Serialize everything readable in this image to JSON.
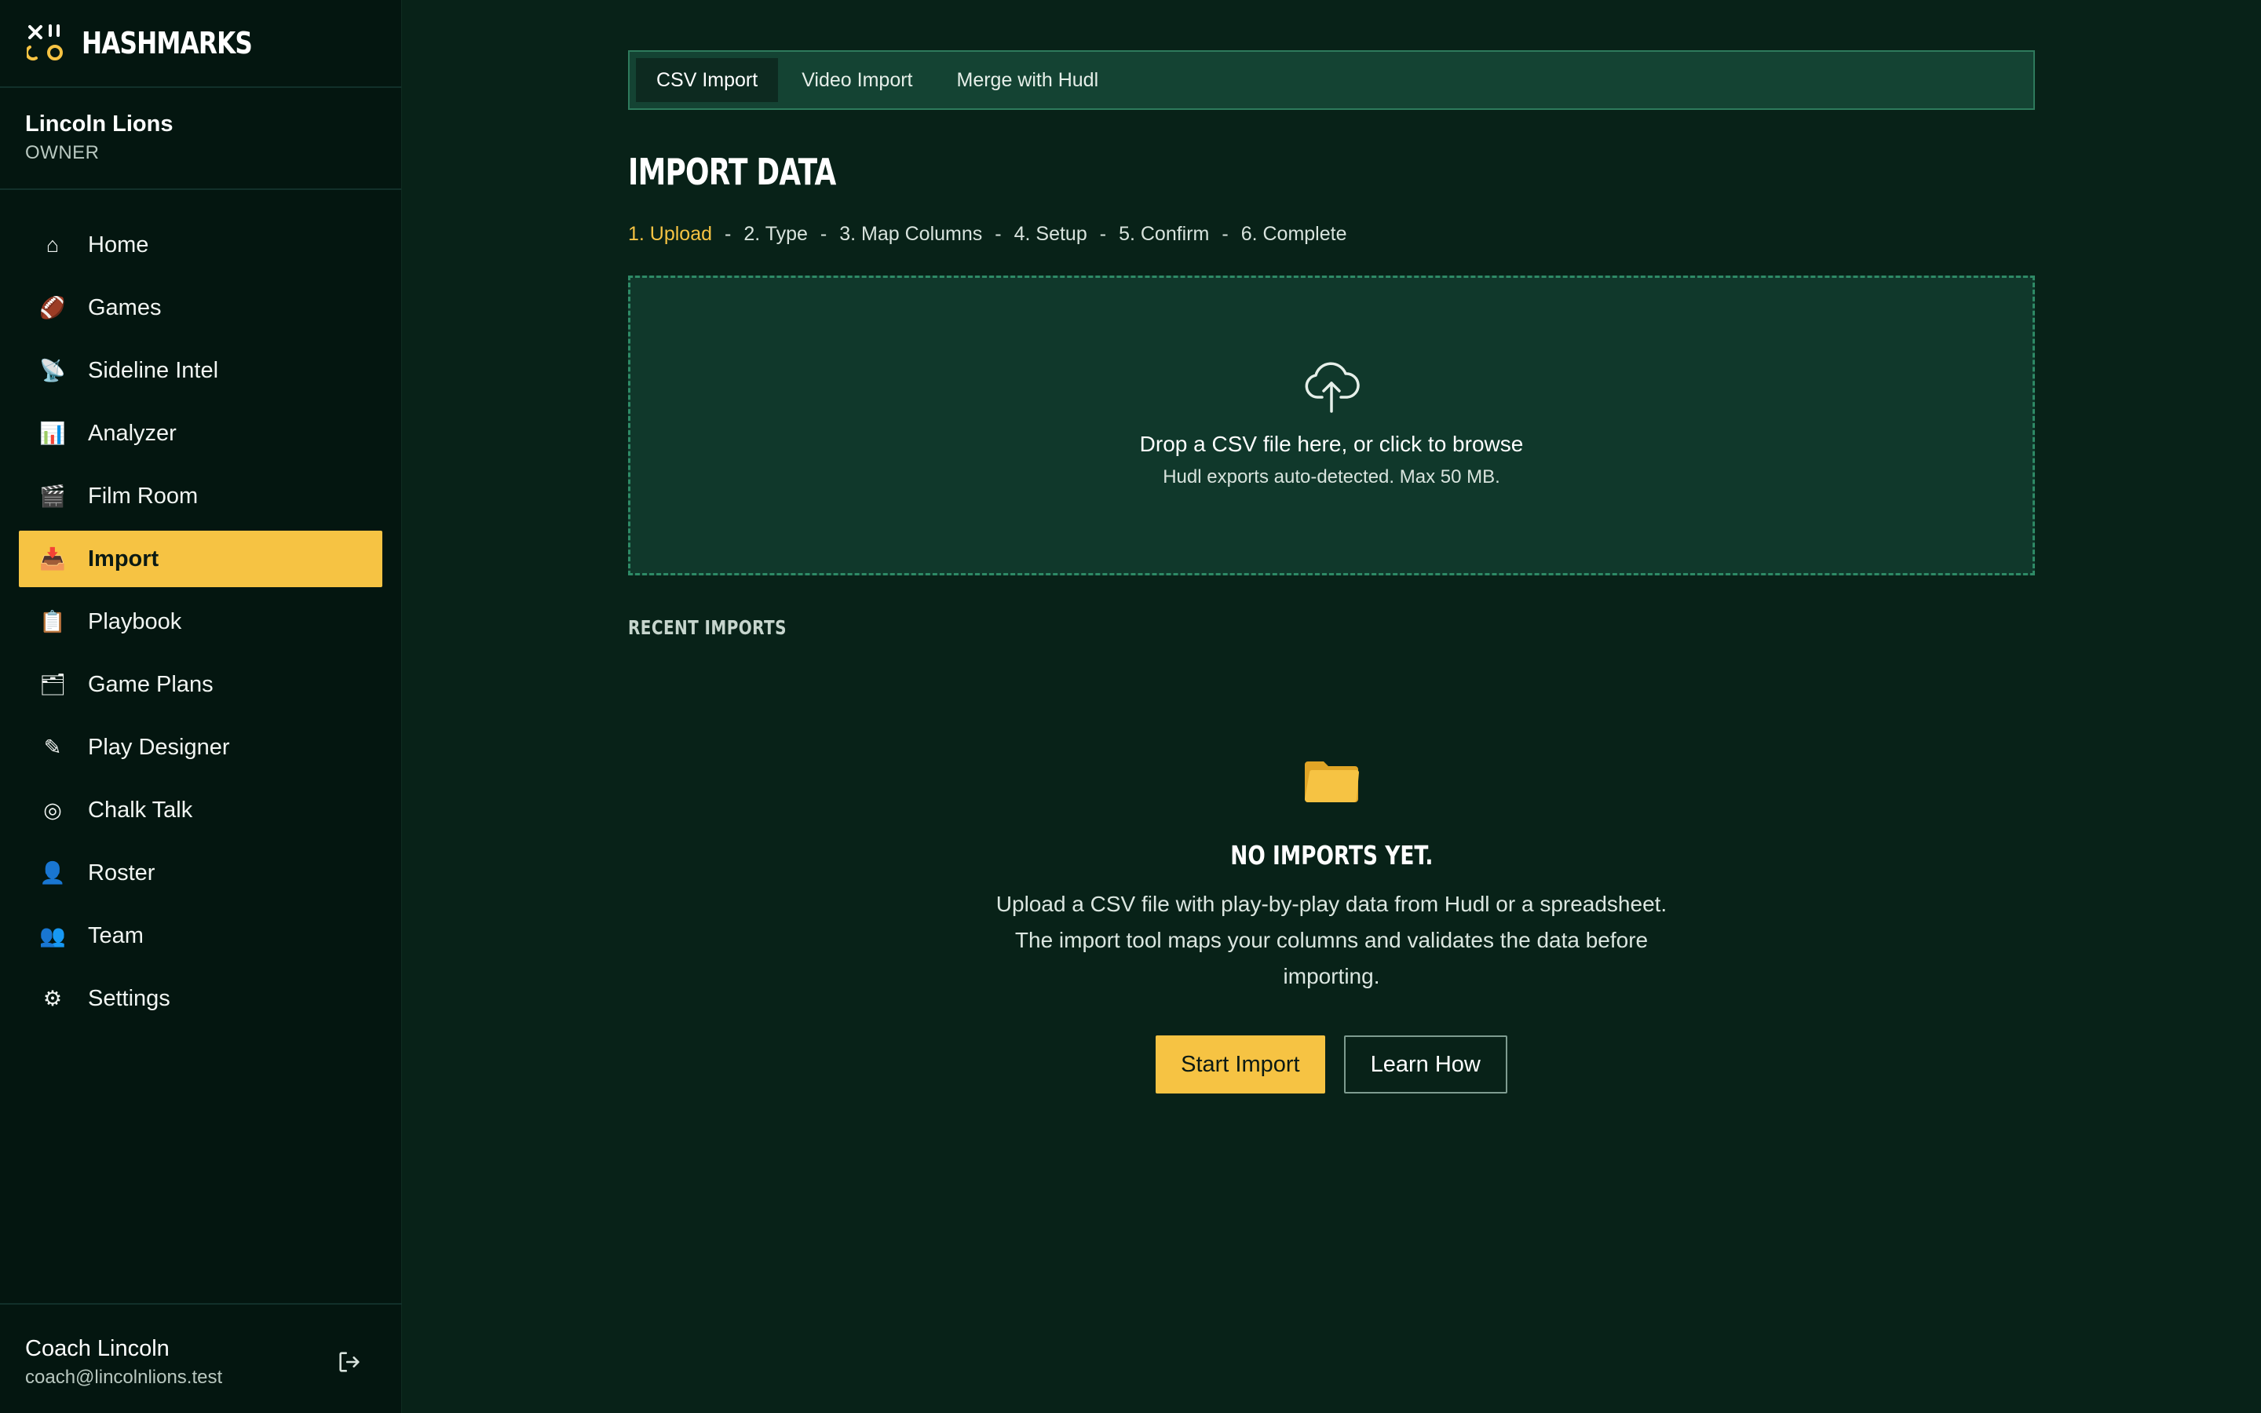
{
  "app": {
    "name": "HASHMARKS"
  },
  "team": {
    "name": "Lincoln Lions",
    "role": "OWNER"
  },
  "sidebar": {
    "items": [
      {
        "label": "Home",
        "icon": "⌂",
        "icon_name": "home-icon"
      },
      {
        "label": "Games",
        "icon": "🏈",
        "icon_name": "football-icon"
      },
      {
        "label": "Sideline Intel",
        "icon": "📡",
        "icon_name": "satellite-icon"
      },
      {
        "label": "Analyzer",
        "icon": "📊",
        "icon_name": "bar-chart-icon"
      },
      {
        "label": "Film Room",
        "icon": "🎬",
        "icon_name": "clapperboard-icon"
      },
      {
        "label": "Import",
        "icon": "📥",
        "icon_name": "inbox-tray-icon",
        "active": true
      },
      {
        "label": "Playbook",
        "icon": "📋",
        "icon_name": "clipboard-icon"
      },
      {
        "label": "Game Plans",
        "icon": "🗂",
        "icon_name": "card-index-icon"
      },
      {
        "label": "Play Designer",
        "icon": "✎",
        "icon_name": "pencil-icon"
      },
      {
        "label": "Chalk Talk",
        "icon": "◎",
        "icon_name": "target-icon"
      },
      {
        "label": "Roster",
        "icon": "👤",
        "icon_name": "person-icon"
      },
      {
        "label": "Team",
        "icon": "👥",
        "icon_name": "people-icon"
      },
      {
        "label": "Settings",
        "icon": "⚙",
        "icon_name": "gear-icon"
      }
    ]
  },
  "user": {
    "name": "Coach Lincoln",
    "email": "coach@lincolnlions.test"
  },
  "tabs": [
    {
      "label": "CSV Import",
      "active": true
    },
    {
      "label": "Video Import"
    },
    {
      "label": "Merge with Hudl"
    }
  ],
  "page": {
    "title": "IMPORT DATA"
  },
  "steps": [
    "1. Upload",
    "2. Type",
    "3. Map Columns",
    "4. Setup",
    "5. Confirm",
    "6. Complete"
  ],
  "step_separator": "-",
  "dropzone": {
    "main": "Drop a CSV file here, or click to browse",
    "sub": "Hudl exports auto-detected. Max 50 MB."
  },
  "recent": {
    "title": "RECENT IMPORTS",
    "empty_title": "NO IMPORTS YET.",
    "empty_desc": "Upload a CSV file with play-by-play data from Hudl or a spreadsheet. The import tool maps your columns and validates the data before importing.",
    "start_label": "Start Import",
    "learn_label": "Learn How"
  },
  "colors": {
    "background": "#082218",
    "sidebar": "#041610",
    "accent": "#f6c343",
    "panel": "#10382b",
    "tabbar": "#144333"
  }
}
